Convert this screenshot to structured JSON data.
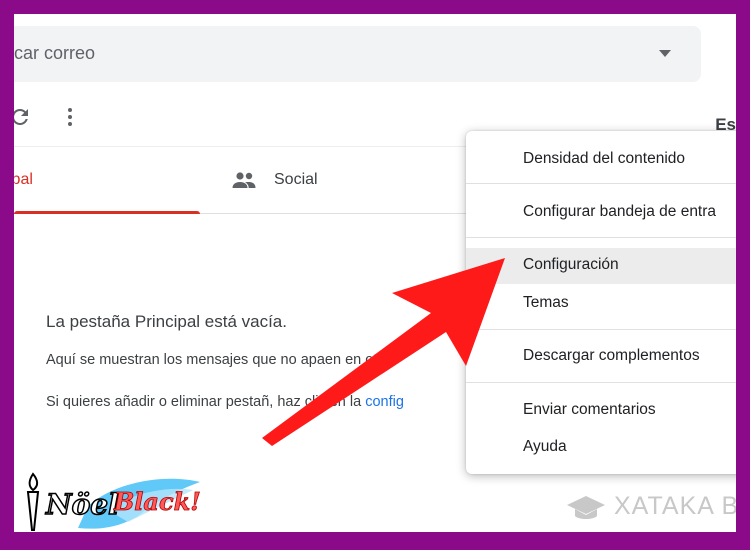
{
  "search": {
    "placeholder_fragment": "car correo"
  },
  "toolbar": {
    "lang_fragment": "Es"
  },
  "tabs": [
    {
      "label": "cipal"
    },
    {
      "label": "Social"
    }
  ],
  "empty_state": {
    "title": "La pestaña Principal está vacía.",
    "line1": "Aquí se muestran los mensajes que no apa",
    "line1_tail": "en en otra",
    "line2": "Si quieres añadir o eliminar pestañ",
    "line2_mid": ", haz clic en la ",
    "line2_link": "config"
  },
  "menu": {
    "items": [
      {
        "label": "Densidad del contenido"
      },
      {
        "label": "Configurar bandeja de entra"
      },
      {
        "label": "Configuración"
      },
      {
        "label": "Temas"
      },
      {
        "label": "Descargar complementos"
      },
      {
        "label": "Enviar comentarios"
      },
      {
        "label": "Ayuda"
      }
    ]
  },
  "watermark": {
    "text": "XATAKA BA"
  },
  "logo": {
    "text1": "Nöel",
    "text2": "Black!"
  },
  "colors": {
    "frame": "#8a0a8a",
    "accent_red": "#d93025",
    "link_blue": "#1a73e8",
    "arrow_red": "#ff1a1a"
  },
  "icons": [
    "caret-down-icon",
    "refresh-icon",
    "more-vert-icon",
    "people-icon",
    "graduation-cap-icon",
    "torch-icon"
  ]
}
